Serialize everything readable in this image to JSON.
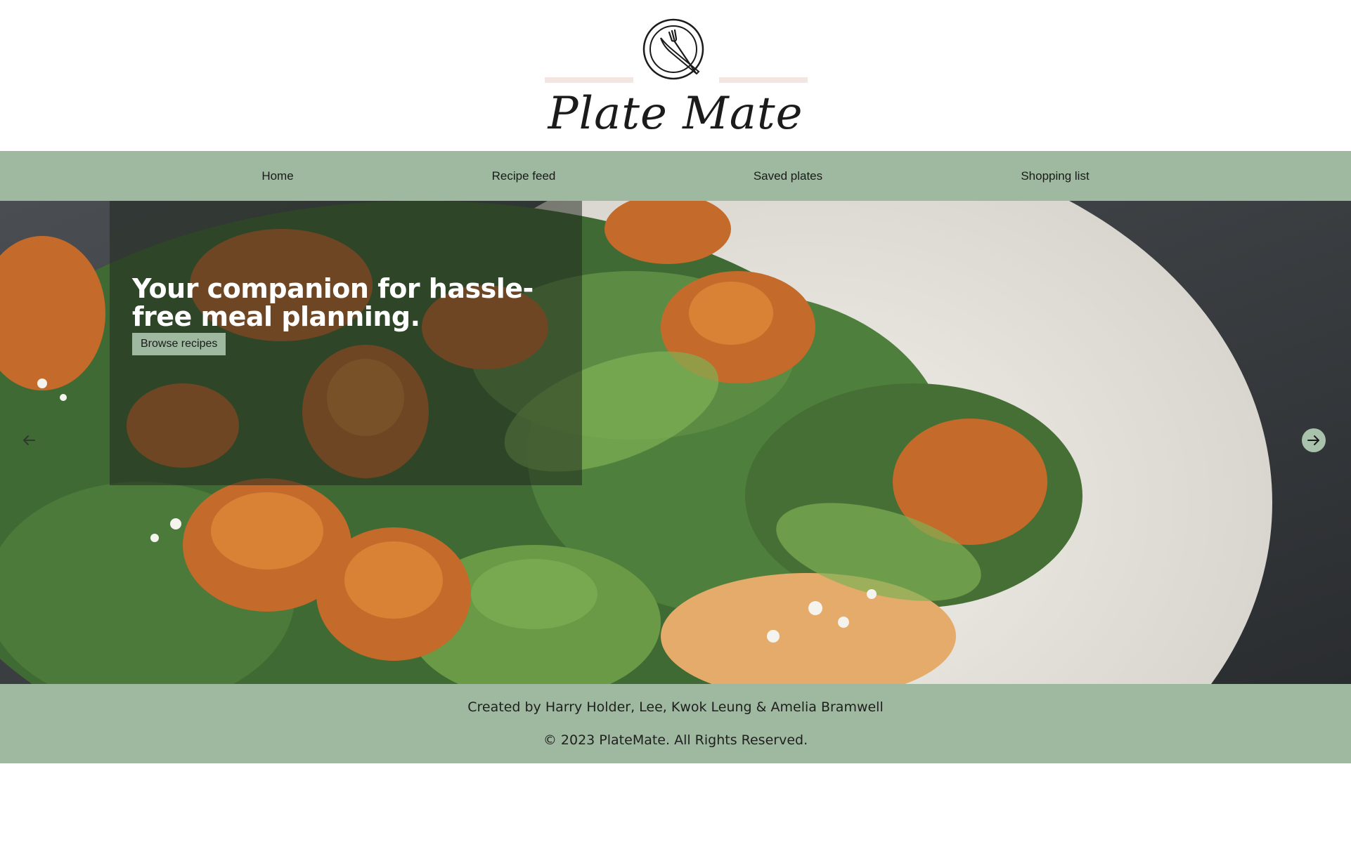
{
  "brand": {
    "name": "Plate Mate",
    "logo_icon": "plate-fork-knife-icon"
  },
  "nav": {
    "items": [
      {
        "label": "Home"
      },
      {
        "label": "Recipe feed"
      },
      {
        "label": "Saved plates"
      },
      {
        "label": "Shopping list"
      }
    ]
  },
  "hero": {
    "headline": "Your companion for hassle-free meal planning.",
    "cta_label": "Browse recipes",
    "image_alt": "salad with spiced chicken, spinach and feta",
    "prev_icon": "arrow-left-icon",
    "next_icon": "arrow-right-icon"
  },
  "footer": {
    "credits": "Created by Harry Holder, Lee, Kwok Leung & Amelia Bramwell",
    "copyright": "© 2023 PlateMate. All Rights Reserved."
  },
  "colors": {
    "accent_green": "#9eb9a0",
    "logo_rule": "#f3e6e0",
    "text_dark": "#1a1a1a"
  }
}
